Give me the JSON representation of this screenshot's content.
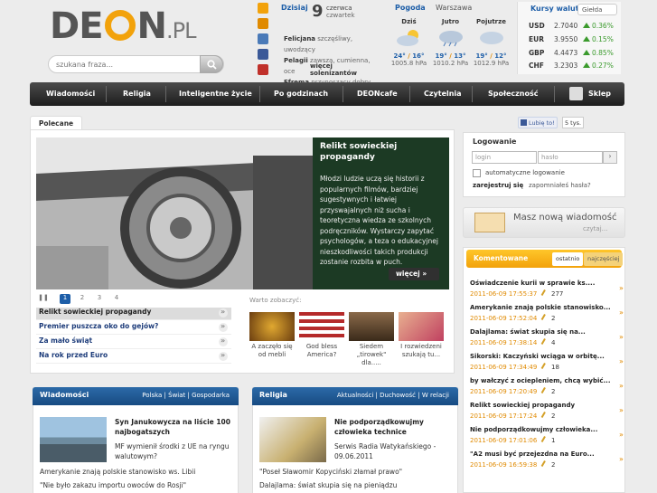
{
  "logo": {
    "main": "DEON",
    "suffix": ".PL"
  },
  "search": {
    "placeholder": "szukana fraza..."
  },
  "today": {
    "label": "Dzisiaj",
    "day": "9",
    "month": "czerwca",
    "weekday": "czwartek",
    "names": [
      {
        "name": "Felicjana",
        "text": "szczęśliwy, uwodzący"
      },
      {
        "name": "Pelagii",
        "text": "zawsza, cumienna, oce"
      },
      {
        "name": "Efrema",
        "text": "przynoszący dobry owoc"
      }
    ],
    "more": "więcej solenizantów"
  },
  "weather": {
    "title": "Pogoda",
    "city": "Warszawa",
    "days": [
      {
        "label": "Dziś",
        "hi": "24°",
        "lo": "16°",
        "pressure": "1005.8 hPa"
      },
      {
        "label": "Jutro",
        "hi": "19°",
        "lo": "13°",
        "pressure": "1010.2 hPa"
      },
      {
        "label": "Pojutrze",
        "hi": "19°",
        "lo": "12°",
        "pressure": "1012.9 hPa"
      }
    ]
  },
  "currency": {
    "title": "Kursy walut",
    "tab": "Giełda",
    "rows": [
      {
        "code": "USD",
        "value": "2.7040",
        "change": "0.36%"
      },
      {
        "code": "EUR",
        "value": "3.9550",
        "change": "0.15%"
      },
      {
        "code": "GBP",
        "value": "4.4473",
        "change": "0.85%"
      },
      {
        "code": "CHF",
        "value": "3.2303",
        "change": "0.27%"
      }
    ],
    "up_color": "#3a9a2c"
  },
  "nav": {
    "items": [
      "Wiadomości",
      "Religia",
      "Inteligentne życie",
      "Po godzinach",
      "DEONcafe",
      "Czytelnia",
      "Społeczność",
      "Sklep"
    ]
  },
  "social": {
    "like": "Lubię to!",
    "count": "5 tys."
  },
  "featured": {
    "tab": "Polecane",
    "title": "Relikt sowieckiej propagandy",
    "text": "Młodzi ludzie uczą się historii z popularnych filmów, bardziej sugestywnych i łatwiej przyswajalnych niż sucha i teoretyczna wiedza ze szkolnych podręczników. Wystarczy zapytać psychologów, a teza o edukacyjnej nieszkodliwości takich produkcji zostanie rozbita w puch.",
    "more": "więcej",
    "pages": [
      "1",
      "2",
      "3",
      "4"
    ],
    "list": [
      "Relikt sowieckiej propagandy",
      "Premier puszcza oko do gejów?",
      "Za mało świąt",
      "Na rok przed Euro"
    ]
  },
  "see_also": {
    "label": "Warto zobaczyć:",
    "items": [
      "A zaczęło się od mebli",
      "God bless America?",
      "Siedem „tirowek\" dla.....",
      "I rozwiedzeni szukają tu..."
    ]
  },
  "sections": [
    {
      "title": "Wiadomości",
      "links": "Polska  |  Świat  |  Gospodarka",
      "headline": "Syn Janukowycza na liście 100 najbogatszych",
      "sub": "MF wymienił środki z UE na ryngu walutowym?",
      "lines": [
        "Amerykanie znają polskie stanowisko ws. Libii",
        "\"Nie było zakazu importu owoców do Rosji\""
      ]
    },
    {
      "title": "Religia",
      "links": "Aktualności  |  Duchowość  |  W relacji",
      "headline": "Nie podporządkowujmy człowieka technice",
      "sub": "Serwis Radia Watykańskiego - 09.06.2011",
      "lines": [
        "\"Poseł Sławomir Kopyciński złamał prawo\"",
        "Dalajlama: świat skupia się na pieniądzu"
      ]
    }
  ],
  "login": {
    "title": "Logowanie",
    "login_placeholder": "login",
    "pass_placeholder": "hasło",
    "go": "›",
    "auto": "automatyczne logowanie",
    "register": "zarejestruj się",
    "forgot": "zapomniałeś hasła?"
  },
  "message": {
    "text": "Masz nową wiadomość",
    "sub": "czytaj..."
  },
  "comments": {
    "title": "Komentowane",
    "tabs": [
      "ostatnio",
      "najczęściej"
    ],
    "items": [
      {
        "title": "Oświadczenie kurii w sprawie ks....",
        "date": "2011-06-09 17:55:37",
        "count": "277"
      },
      {
        "title": "Amerykanie znają polskie stanowisko...",
        "date": "2011-06-09 17:52:04",
        "count": "2"
      },
      {
        "title": "Dalajlama: świat skupia się na...",
        "date": "2011-06-09 17:38:14",
        "count": "4"
      },
      {
        "title": "Sikorski: Kaczyński wciąga w orbitę...",
        "date": "2011-06-09 17:34:49",
        "count": "18"
      },
      {
        "title": "by wałczyć z ociepleniem, chcą wybić...",
        "date": "2011-06-09 17:20:49",
        "count": "2"
      },
      {
        "title": "Relikt sowieckiej propagandy",
        "date": "2011-06-09 17:17:24",
        "count": "2"
      },
      {
        "title": "Nie podporządkowujmy człowieka...",
        "date": "2011-06-09 17:01:06",
        "count": "1"
      },
      {
        "title": "\"A2 musi być przejezdna na Euro...",
        "date": "2011-06-09 16:59:38",
        "count": "2"
      }
    ]
  }
}
